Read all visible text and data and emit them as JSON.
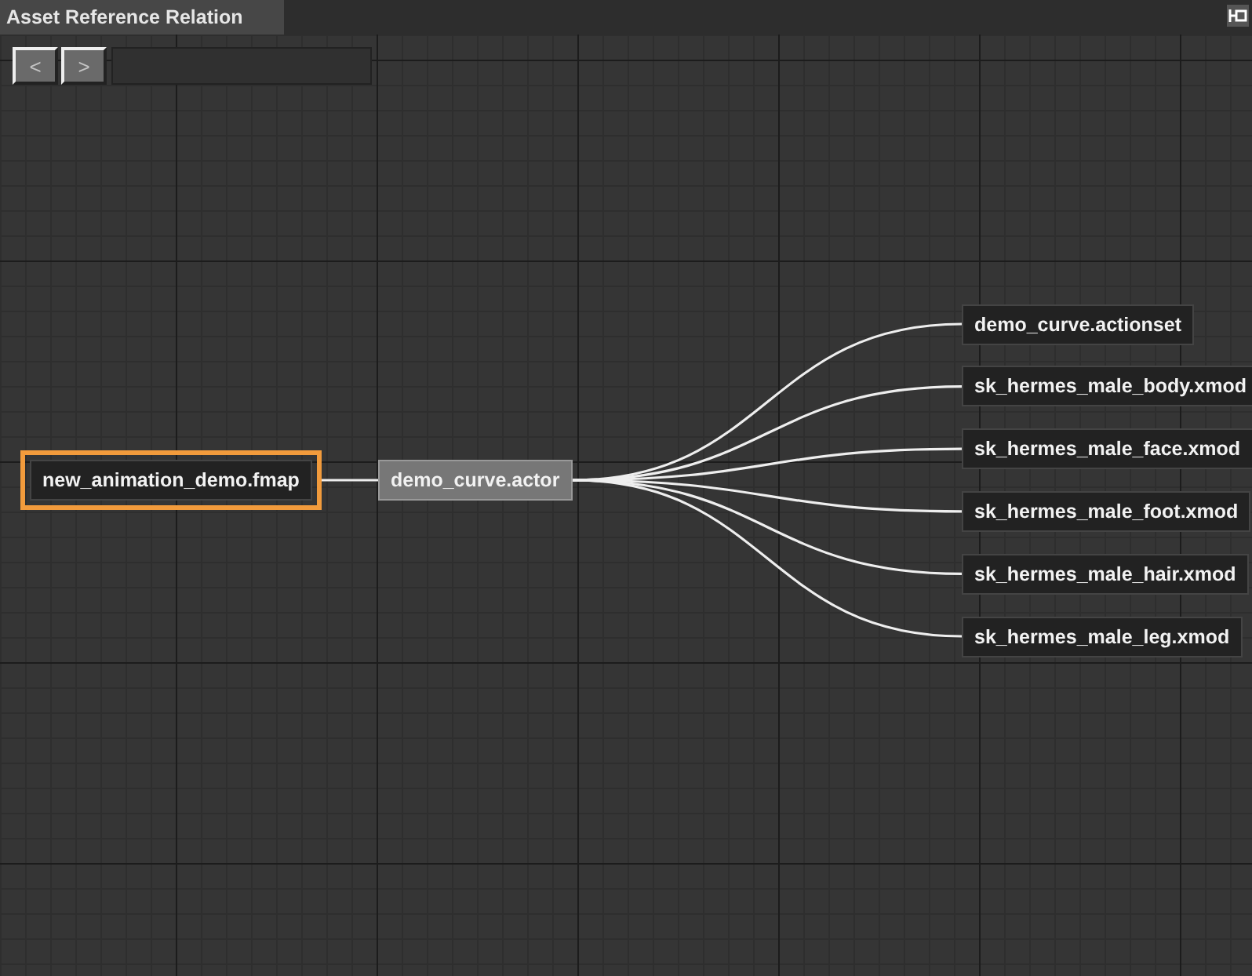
{
  "window": {
    "title": "Asset Reference Relation"
  },
  "toolbar": {
    "buttons": [
      {
        "label": "<",
        "disabled": true
      },
      {
        "label": ">",
        "disabled": true
      }
    ]
  },
  "graph": {
    "root": {
      "label": "new_animation_demo.fmap",
      "current": false,
      "selected": true,
      "children": [
        {
          "label": "demo_curve.actor",
          "current": true,
          "selected": false,
          "children": [
            {
              "label": "demo_curve.actionset",
              "current": false,
              "selected": false
            },
            {
              "label": "sk_hermes_male_body.xmod",
              "current": false,
              "selected": false
            },
            {
              "label": "sk_hermes_male_face.xmod",
              "current": false,
              "selected": false
            },
            {
              "label": "sk_hermes_male_foot.xmod",
              "current": false,
              "selected": false
            },
            {
              "label": "sk_hermes_male_hair.xmod",
              "current": false,
              "selected": false
            },
            {
              "label": "sk_hermes_male_leg.xmod",
              "current": false,
              "selected": false
            }
          ]
        }
      ]
    }
  }
}
